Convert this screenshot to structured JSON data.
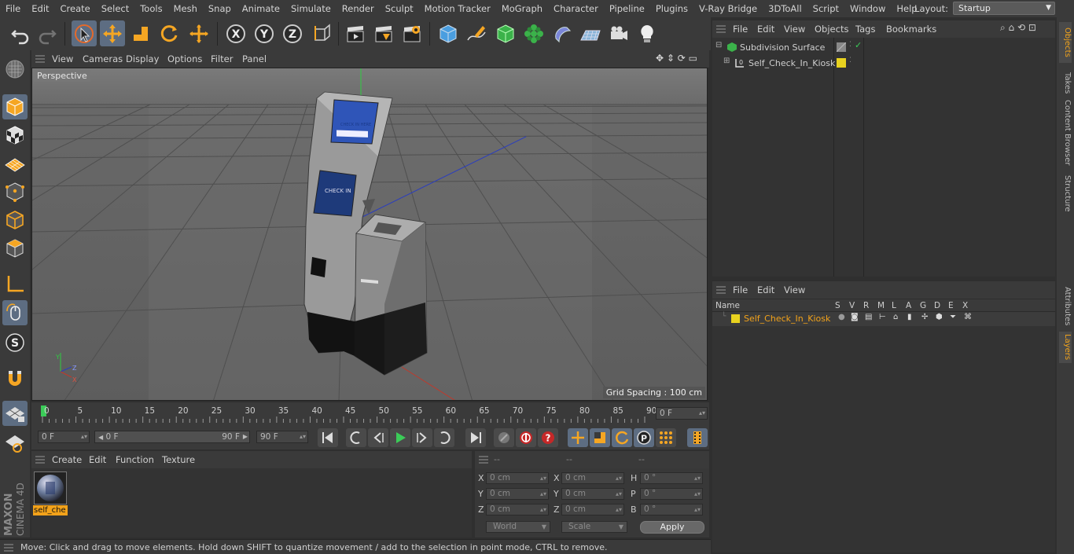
{
  "menubar": {
    "items": [
      "File",
      "Edit",
      "Create",
      "Select",
      "Tools",
      "Mesh",
      "Snap",
      "Animate",
      "Simulate",
      "Render",
      "Sculpt",
      "Motion Tracker",
      "MoGraph",
      "Character",
      "Pipeline",
      "Plugins",
      "V-Ray Bridge",
      "3DToAll",
      "Script",
      "Window",
      "Help"
    ],
    "layout_label": "Layout:",
    "layout_value": "Startup"
  },
  "viewport": {
    "menu": [
      "View",
      "Cameras",
      "Display",
      "Options",
      "Filter",
      "Panel"
    ],
    "camera_label": "Perspective",
    "grid_spacing": "Grid Spacing : 100 cm",
    "kiosk_screen_top": "CHECK IN HERE",
    "kiosk_screen_mid": "CHECK IN"
  },
  "timeline": {
    "ticks": [
      "0",
      "5",
      "10",
      "15",
      "20",
      "25",
      "30",
      "35",
      "40",
      "45",
      "50",
      "55",
      "60",
      "65",
      "70",
      "75",
      "80",
      "85",
      "90"
    ],
    "current_frame": "0 F",
    "start_field": "0 F",
    "range_start": "0 F",
    "range_end": "90 F",
    "end_field": "90 F"
  },
  "material_manager": {
    "menu": [
      "Create",
      "Edit",
      "Function",
      "Texture"
    ],
    "material_name": "self_che"
  },
  "coordinates": {
    "headers": [
      "--",
      "--",
      "--"
    ],
    "rows": [
      {
        "l1": "X",
        "v1": "0 cm",
        "l2": "X",
        "v2": "0 cm",
        "l3": "H",
        "v3": "0 °"
      },
      {
        "l1": "Y",
        "v1": "0 cm",
        "l2": "Y",
        "v2": "0 cm",
        "l3": "P",
        "v3": "0 °"
      },
      {
        "l1": "Z",
        "v1": "0 cm",
        "l2": "Z",
        "v2": "0 cm",
        "l3": "B",
        "v3": "0 °"
      }
    ],
    "mode_world": "World",
    "mode_scale": "Scale",
    "apply": "Apply"
  },
  "status": {
    "text": "Move: Click and drag to move elements. Hold down SHIFT to quantize movement / add to the selection in point mode, CTRL to remove."
  },
  "object_manager": {
    "menu": [
      "File",
      "Edit",
      "View",
      "Objects",
      "Tags",
      "Bookmarks"
    ],
    "objects": [
      "Subdivision Surface",
      "Self_Check_In_Kiosk"
    ]
  },
  "layer_manager": {
    "menu": [
      "File",
      "Edit",
      "View"
    ],
    "columns": [
      "Name",
      "S",
      "V",
      "R",
      "M",
      "L",
      "A",
      "G",
      "D",
      "E",
      "X"
    ],
    "layers": [
      "Self_Check_In_Kiosk"
    ]
  },
  "right_tabs": [
    "Objects",
    "Takes",
    "Content Browser",
    "Structure",
    "Attributes",
    "Layers"
  ],
  "colors": {
    "accent_orange": "#f2a21a",
    "layer_yellow": "#e8d21f",
    "selected_tool_bg": "#5d6d82",
    "axis_x": "#c0392b",
    "axis_y": "#2ecc40",
    "axis_z": "#2a3dbf"
  }
}
